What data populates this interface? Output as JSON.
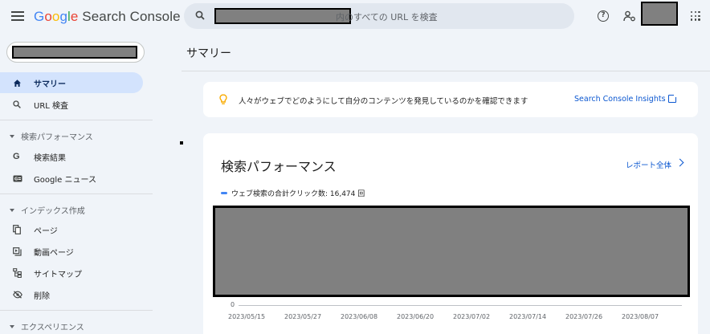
{
  "header": {
    "brand": {
      "google": [
        "G",
        "o",
        "o",
        "g",
        "l",
        "e"
      ],
      "product": "Search Console"
    },
    "search": {
      "placeholder_suffix": "内のすべての URL を検査"
    },
    "icons": {
      "menu": "menu-icon",
      "search": "search-icon",
      "help": "help-icon",
      "users": "manage-users-icon",
      "apps": "apps-grid-icon"
    }
  },
  "sidebar": {
    "items": [
      {
        "label": "サマリー",
        "icon": "home-icon",
        "active": true
      },
      {
        "label": "URL 検査",
        "icon": "search-icon"
      }
    ],
    "sections": [
      {
        "label": "検索パフォーマンス",
        "items": [
          {
            "label": "検索結果",
            "icon": "google-g-icon"
          },
          {
            "label": "Google ニュース",
            "icon": "google-news-icon"
          }
        ]
      },
      {
        "label": "インデックス作成",
        "items": [
          {
            "label": "ページ",
            "icon": "pages-icon"
          },
          {
            "label": "動画ページ",
            "icon": "video-pages-icon"
          },
          {
            "label": "サイトマップ",
            "icon": "sitemap-icon"
          },
          {
            "label": "削除",
            "icon": "removals-icon"
          }
        ]
      },
      {
        "label": "エクスペリエンス",
        "items": []
      }
    ]
  },
  "main": {
    "page_title": "サマリー",
    "insight": {
      "text": "人々がウェブでどのようにして自分のコンテンツを発見しているのかを確認できます",
      "link": "Search Console Insights"
    },
    "performance": {
      "title": "検索パフォーマンス",
      "report_link": "レポート全体",
      "legend": "ウェブ検索の合計クリック数: 16,474 回"
    }
  },
  "chart_data": {
    "type": "line",
    "series": [
      {
        "name": "ウェブ検索の合計クリック数: 16,474 回"
      }
    ],
    "y_tick_labels": [
      "0"
    ],
    "x_tick_labels": [
      "2023/05/15",
      "2023/05/27",
      "2023/06/08",
      "2023/06/20",
      "2023/07/02",
      "2023/07/14",
      "2023/07/26",
      "2023/08/07"
    ]
  },
  "colors": {
    "accent": "#0b57d0",
    "active_nav": "#d3e3fd",
    "background": "#f0f4f9",
    "series": "#4285f4"
  }
}
